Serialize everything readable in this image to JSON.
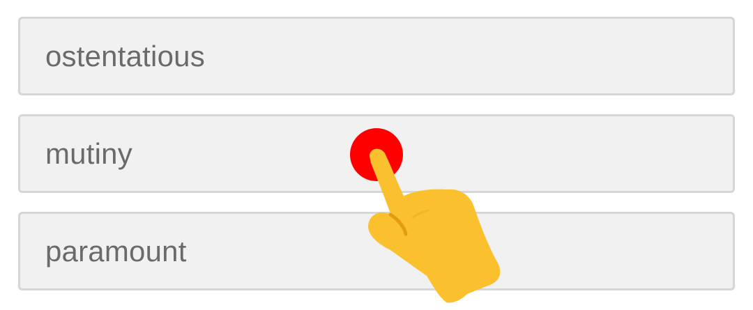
{
  "options": [
    {
      "label": "ostentatious"
    },
    {
      "label": "mutiny"
    },
    {
      "label": "paramount"
    }
  ],
  "tap_indicator": {
    "icon": "pointing-hand-icon",
    "dot_color": "#ff0000",
    "hand_color": "#fbc02d"
  }
}
